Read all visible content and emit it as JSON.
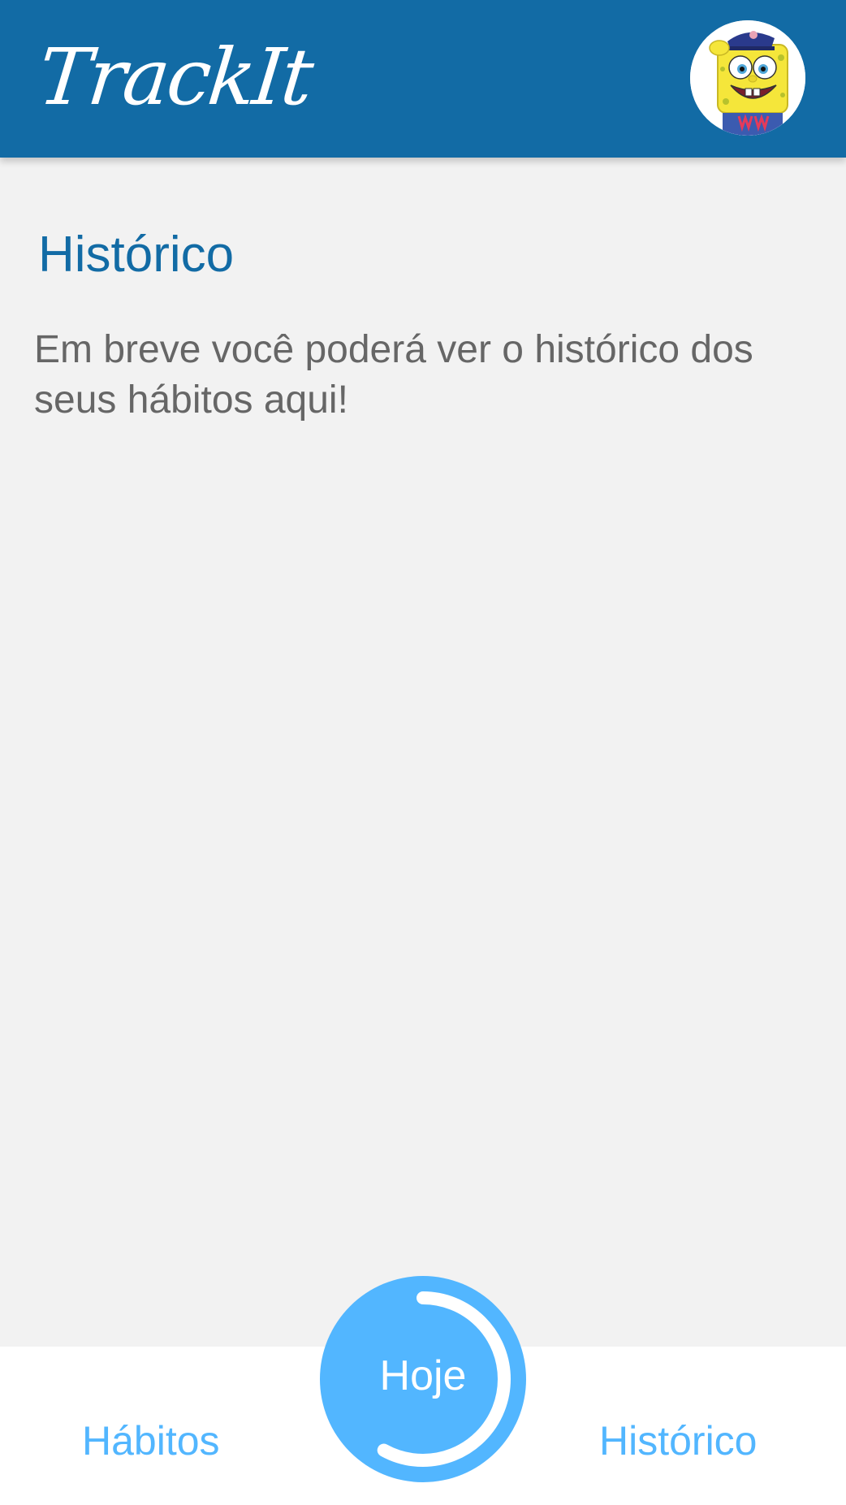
{
  "header": {
    "logo_text": "TrackIt",
    "avatar_icon": "user-avatar-spongebob"
  },
  "main": {
    "title": "Histórico",
    "message": "Em breve você poderá ver o histórico dos seus hábitos aqui!"
  },
  "nav": {
    "habits_label": "Hábitos",
    "today_label": "Hoje",
    "history_label": "Histórico",
    "today_progress": 0.58
  },
  "colors": {
    "primary": "#126ba5",
    "accent": "#52b6ff",
    "background": "#f2f2f2",
    "text_muted": "#666666"
  }
}
